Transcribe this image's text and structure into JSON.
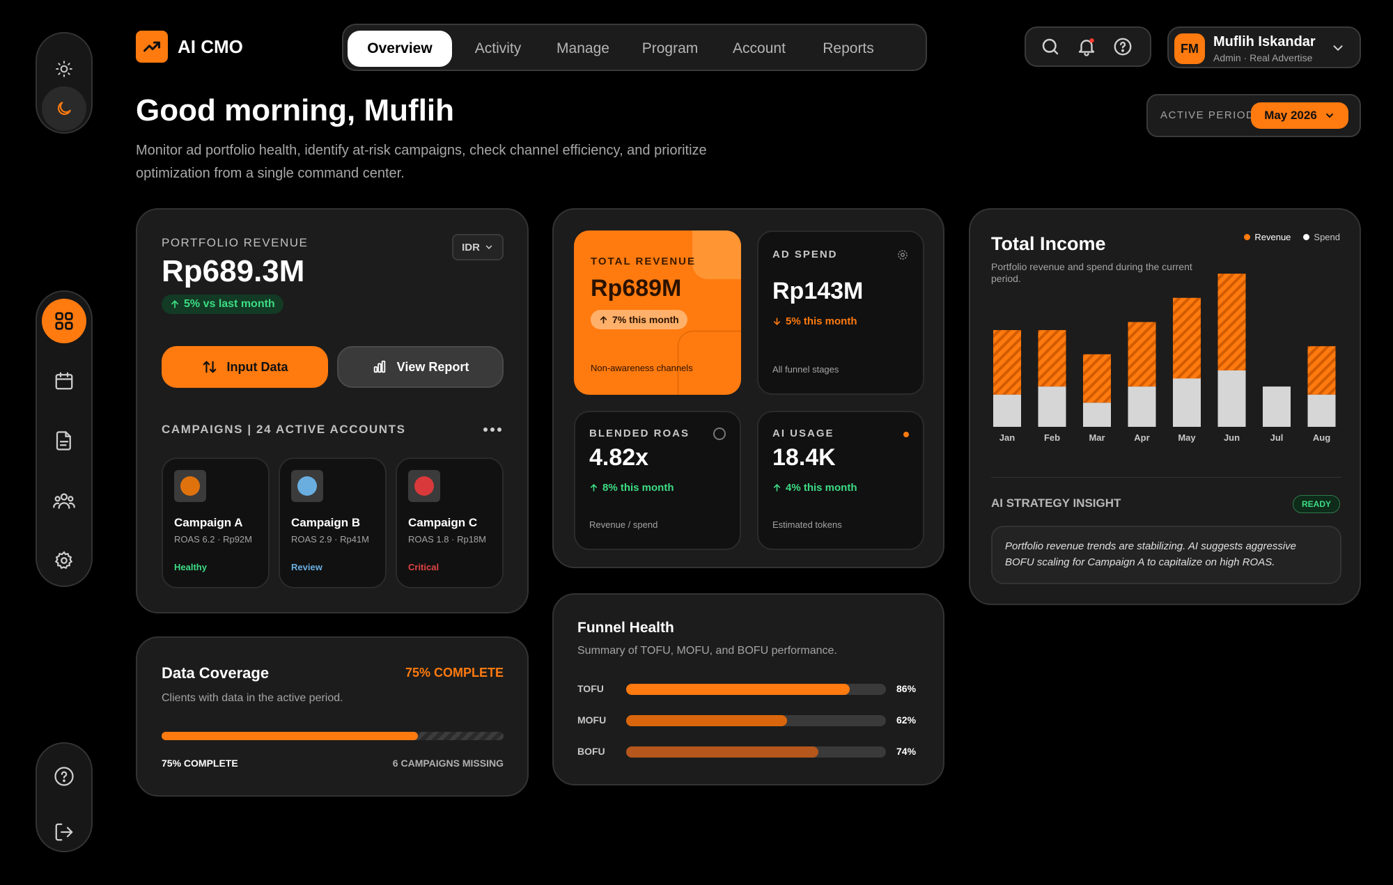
{
  "brand": {
    "name": "AI CMO"
  },
  "nav": {
    "tabs": [
      "Overview",
      "Activity",
      "Manage",
      "Program",
      "Account",
      "Reports"
    ],
    "active": "Overview"
  },
  "user": {
    "initials": "FM",
    "name": "Muflih Iskandar",
    "role": "Admin · Real Advertise"
  },
  "greeting": {
    "title": "Good morning, Muflih",
    "subtitle_line1": "Monitor ad portfolio health, identify at-risk campaigns, check channel efficiency, and prioritize",
    "subtitle_line2": "optimization from a single command center."
  },
  "period": {
    "label": "ACTIVE PERIOD",
    "value": "May 2026"
  },
  "portfolio": {
    "label": "PORTFOLIO REVENUE",
    "currency": "IDR",
    "value": "Rp689.3M",
    "change": "5% vs last month",
    "input_button": "Input Data",
    "report_button": "View Report",
    "campaigns_title": "CAMPAIGNS | 24 ACTIVE ACCOUNTS",
    "campaigns": [
      {
        "name": "Campaign A",
        "meta": "ROAS 6.2 · Rp92M",
        "status": "Healthy",
        "dot_color": "#e0720e",
        "status_color": "#3ddc84"
      },
      {
        "name": "Campaign B",
        "meta": "ROAS 2.9 · Rp41M",
        "status": "Review",
        "dot_color": "#6aaee0",
        "status_color": "#6aaee0"
      },
      {
        "name": "Campaign C",
        "meta": "ROAS 1.8 · Rp18M",
        "status": "Critical",
        "dot_color": "#d9393b",
        "status_color": "#e04445"
      }
    ]
  },
  "coverage": {
    "title": "Data Coverage",
    "badge": "75% COMPLETE",
    "desc": "Clients with data in the active period.",
    "progress": 0.75,
    "footer_left": "75% COMPLETE",
    "footer_right": "6 CAMPAIGNS MISSING"
  },
  "stats": {
    "total_revenue": {
      "label": "TOTAL REVENUE",
      "value": "Rp689M",
      "change": "7% this month",
      "note": "Non-awareness channels"
    },
    "ad_spend": {
      "label": "AD SPEND",
      "value": "Rp143M",
      "change": "5% this month",
      "note": "All funnel stages"
    },
    "roas": {
      "label": "BLENDED ROAS",
      "value": "4.82x",
      "change": "8% this month",
      "note": "Revenue / spend"
    },
    "ai_usage": {
      "label": "AI USAGE",
      "value": "18.4K",
      "change": "4% this month",
      "note": "Estimated tokens"
    }
  },
  "funnel": {
    "title": "Funnel Health",
    "desc": "Summary of TOFU, MOFU, and BOFU performance.",
    "rows": [
      {
        "label": "TOFU",
        "value": 86,
        "display": "86%",
        "color": "#ff7a0f"
      },
      {
        "label": "MOFU",
        "value": 62,
        "display": "62%",
        "color": "#d9660d"
      },
      {
        "label": "BOFU",
        "value": 74,
        "display": "74%",
        "color": "#b5561c"
      }
    ]
  },
  "income": {
    "title": "Total Income",
    "desc_line1": "Portfolio revenue and spend during the current",
    "desc_line2": "period.",
    "insight_title": "AI STRATEGY INSIGHT",
    "insight_badge": "READY",
    "insight_line1": "Portfolio revenue trends are stabilizing. AI suggests aggressive",
    "insight_line2": "BOFU scaling for Campaign A to capitalize on high ROAS."
  },
  "chart_data": {
    "type": "bar",
    "categories": [
      "Jan",
      "Feb",
      "Mar",
      "Apr",
      "May",
      "Jun",
      "Jul",
      "Aug"
    ],
    "series": [
      {
        "name": "Revenue",
        "values": [
          80,
          70,
          60,
          80,
          100,
          120,
          0,
          60
        ],
        "color": "#ff7a0f"
      },
      {
        "name": "Spend",
        "values": [
          40,
          50,
          30,
          50,
          60,
          70,
          50,
          40
        ],
        "color": "#d6d6d6"
      }
    ],
    "stacked": true,
    "legend": "top-right",
    "ylim": [
      0,
      190
    ],
    "grid": false
  }
}
